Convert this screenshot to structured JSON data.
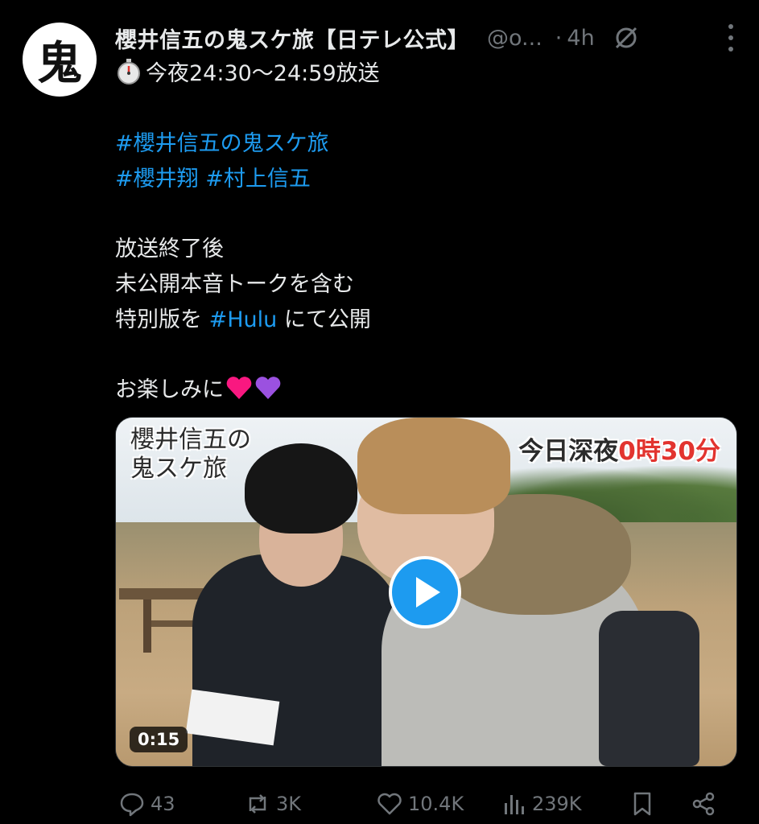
{
  "account": {
    "avatar_glyph": "鬼",
    "display_name": "櫻井信五の鬼スケ旅【日テレ公式】",
    "handle": "@o...",
    "separator": "·",
    "time": "4h"
  },
  "tweet": {
    "line1": "今夜24:30～24:59放送",
    "hashtags_line1": "#櫻井信五の鬼スケ旅",
    "hashtags_line2_a": "#櫻井翔",
    "hashtags_line2_b": "#村上信五",
    "body1": "放送終了後",
    "body2": "未公開本音トークを含む",
    "body3_pre": "特別版を ",
    "body3_tag": "#Hulu",
    "body3_post": " にて公開",
    "body4": "お楽しみに"
  },
  "media": {
    "title_overlay": "櫻井信五の鬼スケ旅",
    "time_overlay_pre": "今日深夜",
    "time_overlay_red": "0時30分",
    "duration": "0:15"
  },
  "actions": {
    "replies": "43",
    "reposts": "3K",
    "likes": "10.4K",
    "views": "239K"
  },
  "colors": {
    "background": "#000000",
    "text": "#e7e9ea",
    "muted": "#71767b",
    "accent": "#1d9bf0",
    "heart_red": "#f91880",
    "heart_purple": "#9b51e0",
    "overlay_red": "#e2342f"
  },
  "icons": [
    "stopwatch-icon",
    "grok-icon",
    "more-icon",
    "play-icon",
    "reply-icon",
    "repost-icon",
    "like-icon",
    "views-icon",
    "bookmark-icon",
    "share-icon",
    "red-heart-emoji",
    "purple-heart-emoji"
  ]
}
